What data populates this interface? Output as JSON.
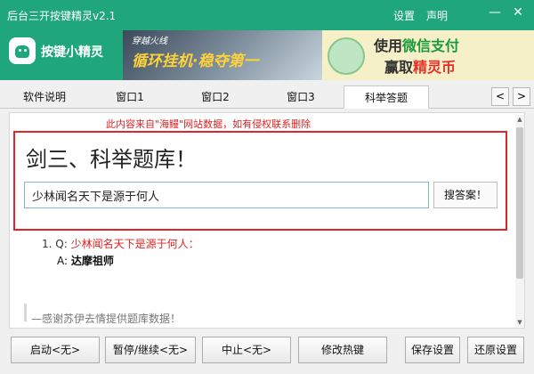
{
  "window": {
    "title": "后台三开按键精灵v2.1",
    "menu_settings": "设置",
    "menu_about": "声明",
    "minimize": "—",
    "close": "✕"
  },
  "header": {
    "logo_text": "按键小精灵",
    "banner1": {
      "sub": "穿越火线",
      "main": "循环挂机·稳夺第一"
    },
    "banner2": {
      "line1_pre": "使用",
      "line1_hl": "微信支付",
      "line2_pre": "赢取",
      "line2_hl": "精灵币"
    }
  },
  "tabs": [
    {
      "label": "软件说明",
      "active": false
    },
    {
      "label": "窗口1",
      "active": false
    },
    {
      "label": "窗口2",
      "active": false
    },
    {
      "label": "窗口3",
      "active": false
    },
    {
      "label": "科举答题",
      "active": true
    }
  ],
  "tab_nav": {
    "prev": "<",
    "next": ">"
  },
  "content": {
    "notice": "此内容来自\"海鳗\"网站数据，如有侵权联系删除",
    "heading": "剑三、科举题库！",
    "search": {
      "value": "少林闻名天下是源于何人",
      "button": "搜答案！"
    },
    "results": [
      {
        "num": "1.",
        "q_label": "Q:",
        "question": "少林闻名天下是源于何人：",
        "a_label": "A:",
        "answer": "达摩祖师"
      }
    ],
    "thanks": "—感谢苏伊去情提供题库数据！"
  },
  "buttons": {
    "start": "启动<无>",
    "pause": "暂停/继续<无>",
    "stop": "中止<无>",
    "hotkey": "修改热键",
    "save": "保存设置",
    "restore": "还原设置"
  },
  "colors": {
    "brand_green": "#1fa67a",
    "highlight_red": "#e0262a"
  }
}
